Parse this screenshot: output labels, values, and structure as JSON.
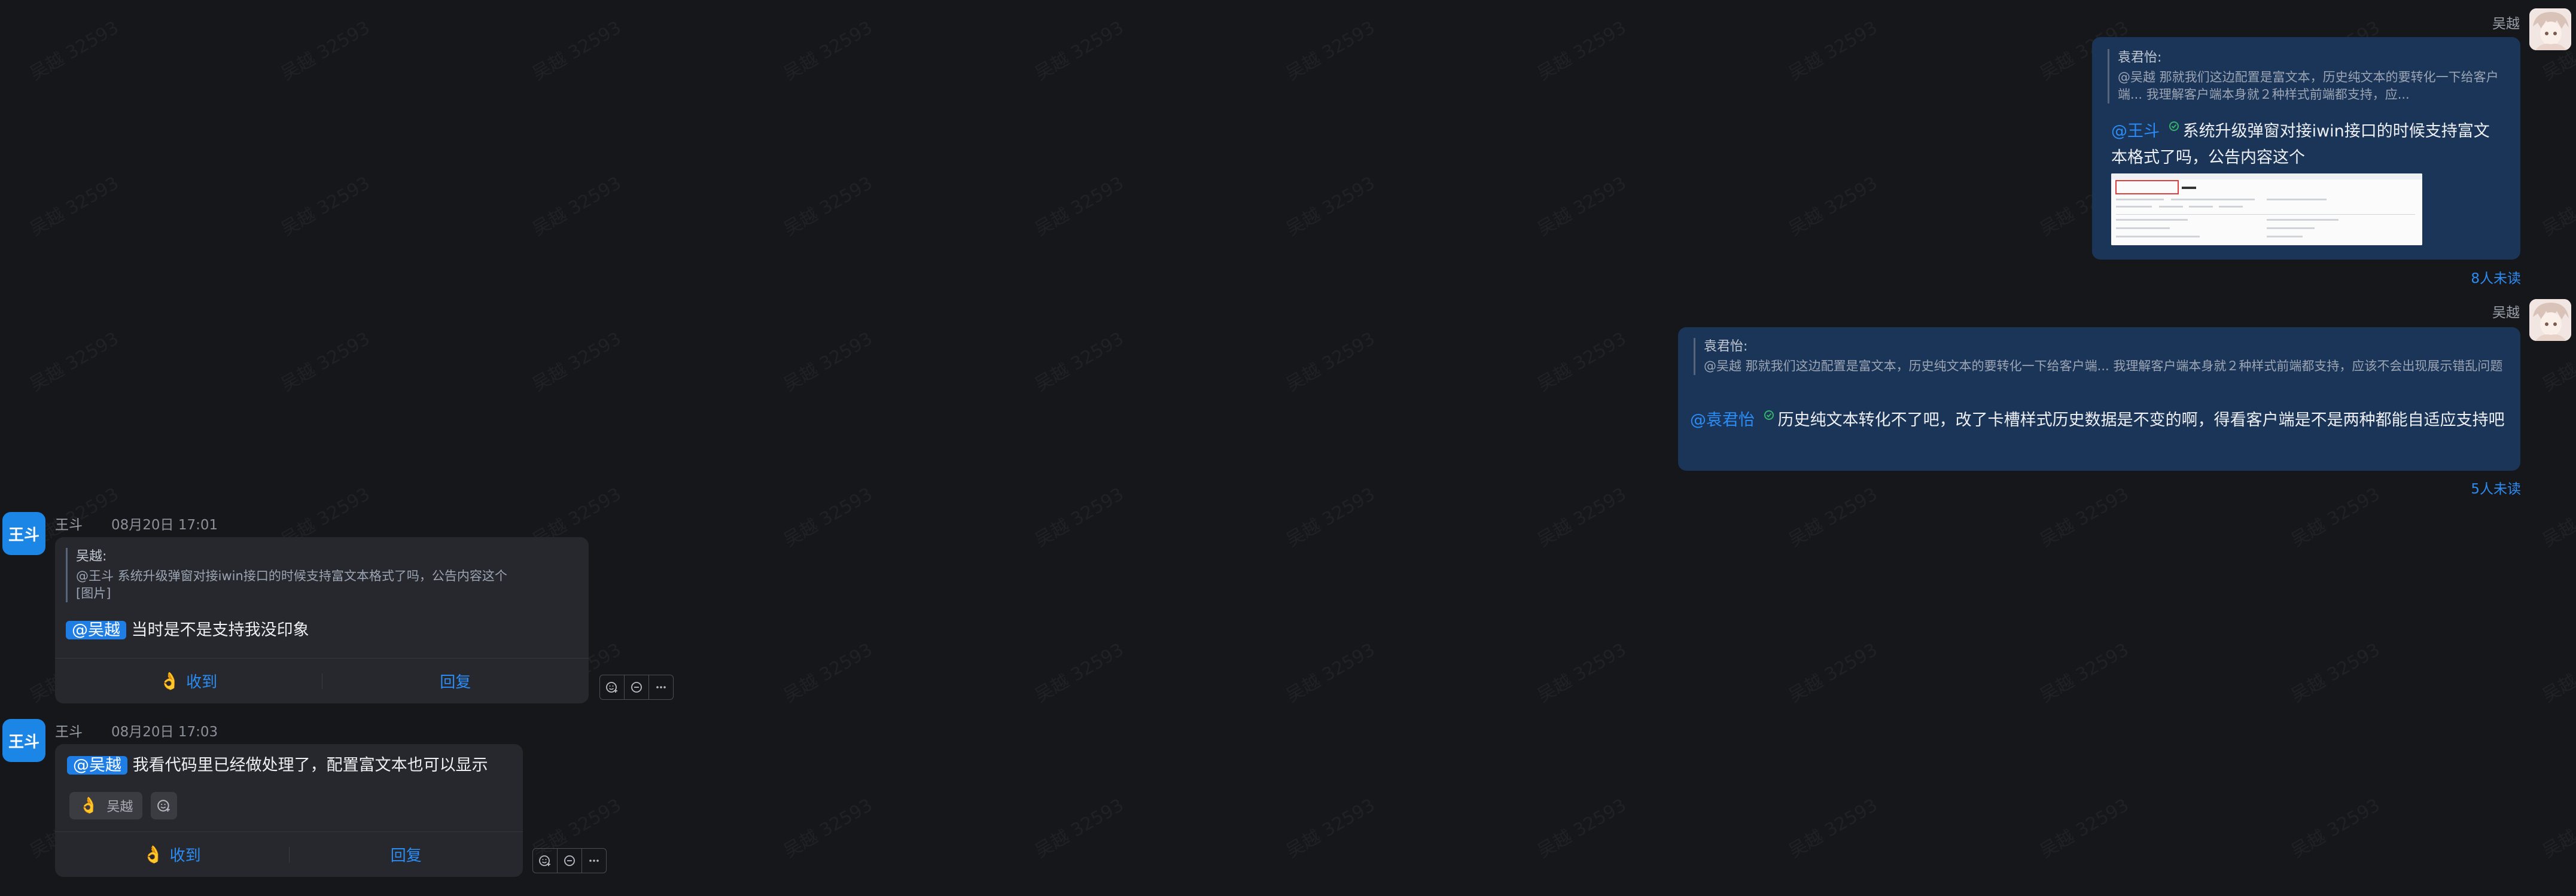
{
  "watermark": "吴越 32593",
  "messages": [
    {
      "sender": "吴越",
      "quote_author": "袁君怡:",
      "quote_text": "@吴越 那就我们这边配置是富文本，历史纯文本的要转化一下给客户端... 我理解客户端本身就２种样式前端都支持，应...",
      "mention": "@王斗",
      "text": "系统升级弹窗对接iwin接口的时候支持富文本格式了吗，公告内容这个",
      "read_status": "8人未读"
    },
    {
      "sender": "吴越",
      "quote_author": "袁君怡:",
      "quote_text": "@吴越 那就我们这边配置是富文本，历史纯文本的要转化一下给客户端... 我理解客户端本身就２种样式前端都支持，应该不会出现展示错乱问题",
      "mention": "@袁君怡",
      "text": "历史纯文本转化不了吧，改了卡槽样式历史数据是不变的啊，得看客户端是不是两种都能自适应支持吧",
      "read_status": "5人未读"
    },
    {
      "sender": "王斗",
      "avatar_text": "王斗",
      "time": "08月20日 17:01",
      "quote_author": "吴越:",
      "quote_text": "@王斗 系统升级弹窗对接iwin接口的时候支持富文本格式了吗，公告内容这个",
      "quote_extra": "[图片]",
      "mention": "@吴越",
      "text": "当时是不是支持我没印象",
      "ack_label": "收到",
      "reply_label": "回复"
    },
    {
      "sender": "王斗",
      "avatar_text": "王斗",
      "time": "08月20日 17:03",
      "mention": "@吴越",
      "text": "我看代码里已经做处理了，配置富文本也可以显示",
      "reaction_user": "吴越",
      "ack_label": "收到",
      "reply_label": "回复"
    }
  ],
  "colors": {
    "background": "#16171b",
    "my_bubble": "#1b3559",
    "other_bubble": "#26282d",
    "accent": "#2b8cf5"
  }
}
